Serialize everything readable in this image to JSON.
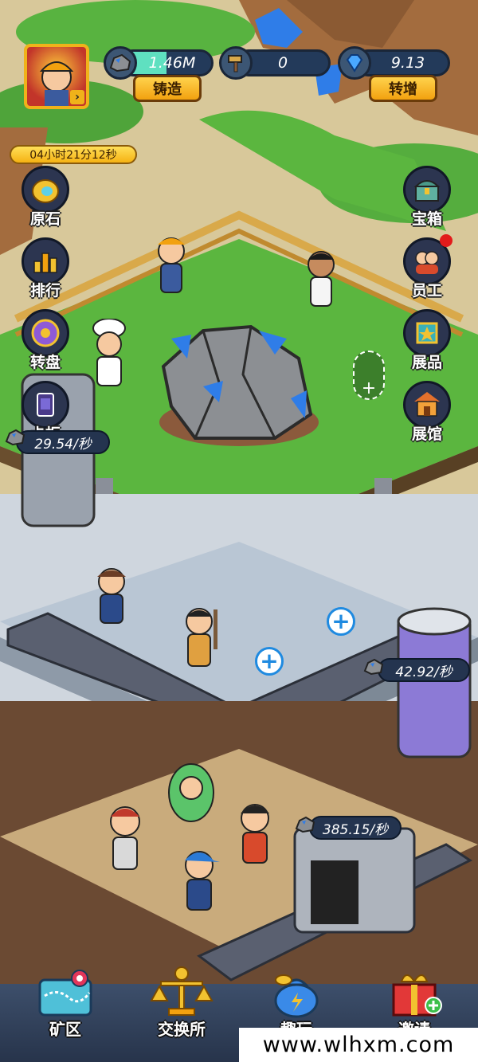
{
  "resources": {
    "ore": {
      "value": "1.46M",
      "button": "铸造"
    },
    "hammer": {
      "value": "0"
    },
    "gem": {
      "value": "9.13",
      "button": "转增"
    }
  },
  "timer": "04小时21分12秒",
  "left_menu": [
    {
      "label": "原石",
      "icon": "gold-ore-icon"
    },
    {
      "label": "排行",
      "icon": "ranking-trophy-icon"
    },
    {
      "label": "转盘",
      "icon": "lucky-wheel-icon"
    },
    {
      "label": "卡柜",
      "icon": "card-cabinet-icon"
    }
  ],
  "right_menu": [
    {
      "label": "宝箱",
      "icon": "treasure-chest-icon"
    },
    {
      "label": "员工",
      "icon": "workers-icon",
      "badge": true
    },
    {
      "label": "展品",
      "icon": "exhibit-icon"
    },
    {
      "label": "展馆",
      "icon": "gallery-icon"
    }
  ],
  "rates": {
    "top": "29.54/秒",
    "middle": "42.92/秒",
    "bottom": "385.15/秒"
  },
  "bottom_nav": [
    {
      "label": "矿区",
      "icon": "mine-map-icon"
    },
    {
      "label": "交换所",
      "icon": "scales-trophy-icon"
    },
    {
      "label": "趣玩",
      "icon": "money-bag-icon"
    },
    {
      "label": "邀请",
      "icon": "gift-box-icon"
    }
  ],
  "watermark": "www.wlhxm.com",
  "colors": {
    "grass": "#5bb63f",
    "floor": "#b9c6d4",
    "dirt": "#6b4a33",
    "gem_blue": "#2f7de8",
    "gold": "#f2a10f",
    "plus_blue": "#1f8ae0"
  }
}
